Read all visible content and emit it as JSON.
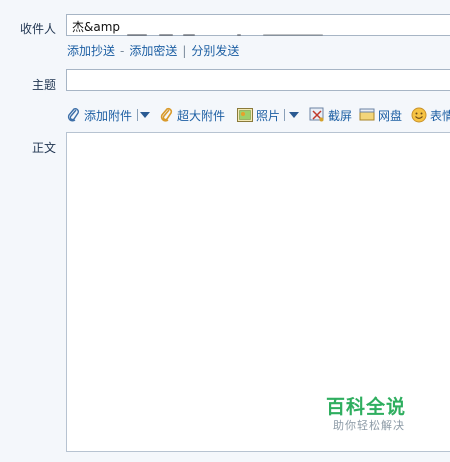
{
  "recipient": {
    "label": "收件人",
    "value": "杰&amp"
  },
  "address_actions": {
    "add_cc": "添加抄送",
    "sep1": "-",
    "add_bcc": "添加密送",
    "sep2": "|",
    "separate_send": "分别发送"
  },
  "subject": {
    "label": "主题",
    "value": ""
  },
  "toolbar": {
    "attach": "添加附件",
    "large_attach": "超大附件",
    "photo": "照片",
    "screenshot": "截屏",
    "netdisk": "网盘",
    "emoji": "表情"
  },
  "body": {
    "label": "正文",
    "value": ""
  },
  "watermark": {
    "title": "百科全说",
    "subtitle": "助你轻松解决"
  }
}
